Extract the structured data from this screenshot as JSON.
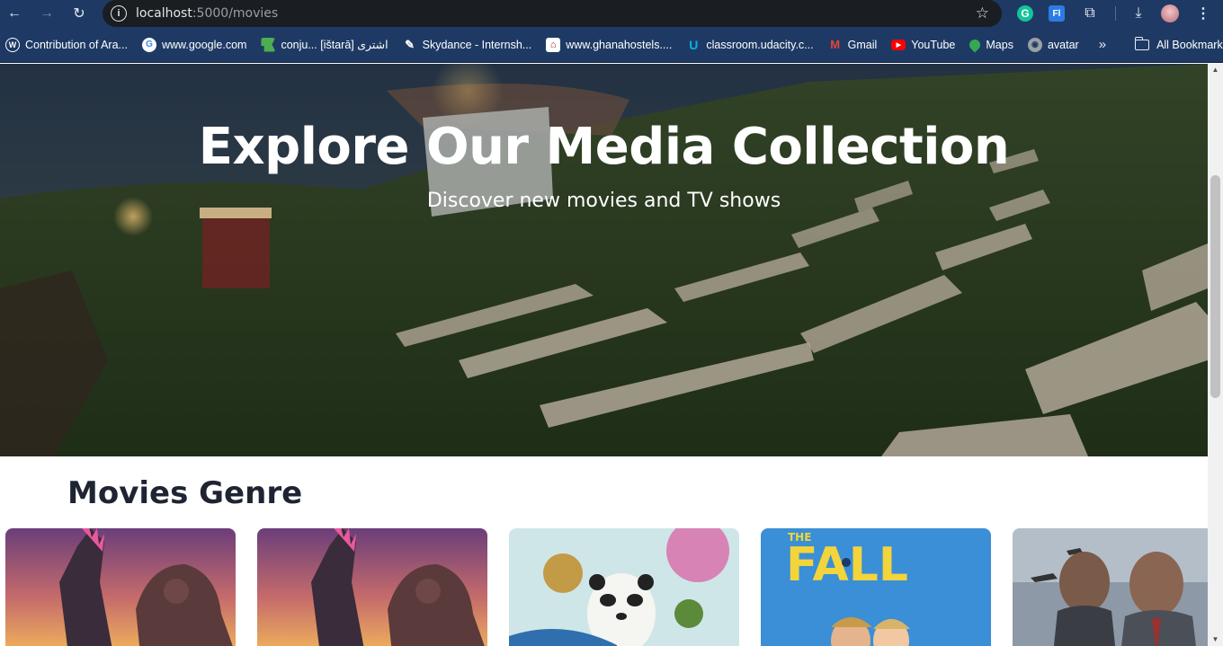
{
  "browser": {
    "url_host": "localhost",
    "url_path": ":5000/movies",
    "bookmarks": [
      {
        "label": "Contribution of Ara...",
        "icon": "wordpress-icon",
        "color": "#ffffff"
      },
      {
        "label": "www.google.com",
        "icon": "google-icon",
        "color": "#ffffff"
      },
      {
        "label": "conju... [ištarā] اشترى",
        "icon": "flag-icon",
        "color": "#4caf50"
      },
      {
        "label": "Skydance - Internsh...",
        "icon": "pen-icon",
        "color": "#ffffff"
      },
      {
        "label": "www.ghanahostels....",
        "icon": "hostel-icon",
        "color": "#ffffff"
      },
      {
        "label": "classroom.udacity.c...",
        "icon": "udacity-icon",
        "color": "#02b3e4"
      },
      {
        "label": "Gmail",
        "icon": "gmail-icon",
        "color": "#ea4335"
      },
      {
        "label": "YouTube",
        "icon": "youtube-icon",
        "color": "#ff0000"
      },
      {
        "label": "Maps",
        "icon": "maps-pin-icon",
        "color": "#34a853"
      },
      {
        "label": "avatar",
        "icon": "globe-icon",
        "color": "#9aa0a6"
      }
    ],
    "all_bookmarks_label": "All Bookmarks",
    "icons": {
      "back": "←",
      "forward": "→",
      "reload": "↻",
      "star": "☆",
      "puzzle": "⧉",
      "download": "⤓",
      "menu": "⋮",
      "more": "»"
    }
  },
  "hero": {
    "title": "Explore Our Media Collection",
    "subtitle": "Discover new movies and TV shows"
  },
  "movies_section": {
    "title": "Movies Genre",
    "posters": [
      {
        "name": "godzilla-kong-poster"
      },
      {
        "name": "godzilla-kong-poster"
      },
      {
        "name": "kung-fu-panda-poster"
      },
      {
        "name": "the-fall-guy-poster"
      },
      {
        "name": "action-thriller-poster"
      }
    ]
  }
}
